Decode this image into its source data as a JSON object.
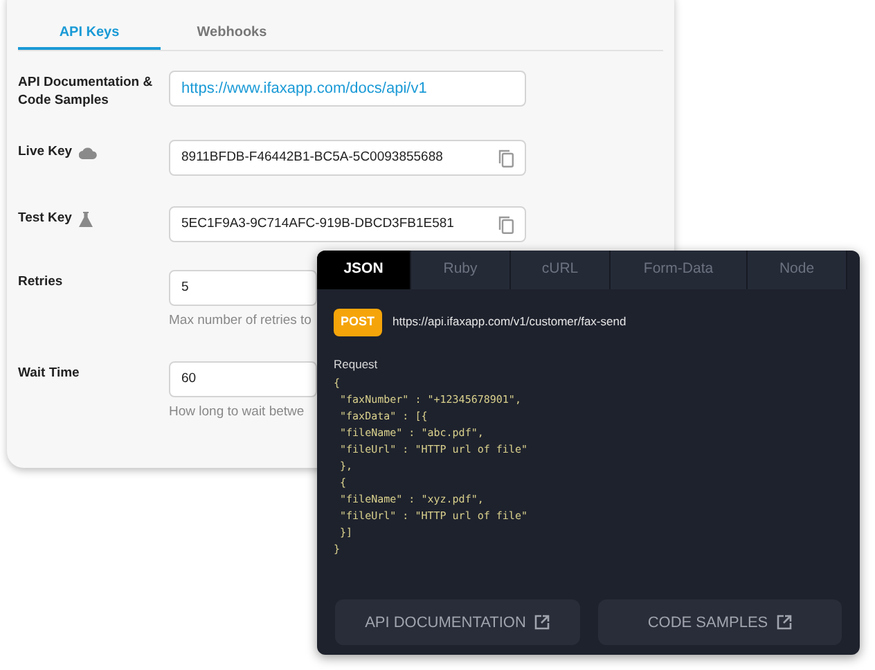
{
  "settings_tabs": [
    {
      "label": "API Keys",
      "selected": true
    },
    {
      "label": "Webhooks",
      "selected": false
    }
  ],
  "fields": [
    {
      "kind": "link",
      "label": "API Documentation & Code Samples",
      "value": "https://www.ifaxapp.com/docs/api/v1"
    },
    {
      "kind": "live_key",
      "label": "Live Key",
      "value": "8911BFDB-F46442B1-BC5A-5C0093855688"
    },
    {
      "kind": "test_key",
      "label": "Test Key",
      "value": "5EC1F9A3-9C714AFC-919B-DBCD3FB1E581"
    },
    {
      "kind": "number",
      "label": "Retries",
      "value": "5",
      "hint": "Max number of retries to"
    },
    {
      "kind": "number",
      "label": "Wait Time",
      "value": "60",
      "hint": "How long to wait betwe"
    }
  ],
  "code_panel": {
    "tabs": [
      {
        "label": "JSON",
        "selected": true
      },
      {
        "label": "Ruby",
        "selected": false
      },
      {
        "label": "cURL",
        "selected": false
      },
      {
        "label": "Form-Data",
        "selected": false
      },
      {
        "label": "Node",
        "selected": false
      }
    ],
    "method": "POST",
    "url": "https://api.ifaxapp.com/v1/customer/fax-send",
    "request_label": "Request",
    "code_lines": [
      "{",
      " \"faxNumber\" : \"+12345678901\",",
      " \"faxData\" : [{",
      " \"fileName\" : \"abc.pdf\",",
      " \"fileUrl\" : \"HTTP url of file\"",
      " },",
      " {",
      " \"fileName\" : \"xyz.pdf\",",
      " \"fileUrl\" : \"HTTP url of file\"",
      " }]",
      "}"
    ],
    "buttons": [
      "API DOCUMENTATION",
      "CODE SAMPLES"
    ]
  }
}
